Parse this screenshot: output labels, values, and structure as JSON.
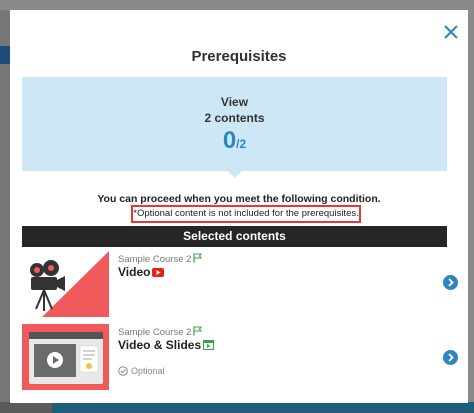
{
  "modal": {
    "title": "Prerequisites",
    "close_icon": "close-icon",
    "status": {
      "line1": "View",
      "line2": "2 contents",
      "completed": "0",
      "total": "/2"
    },
    "condition_text": "You can proceed when you meet the following condition.",
    "note_text": "*Optional content is not included for the prerequisites.",
    "section_title": "Selected contents",
    "items": [
      {
        "course": "Sample Course 2",
        "title": "Video",
        "type_icon": "youtube-icon",
        "optional": ""
      },
      {
        "course": "Sample Course 2",
        "title": "Video & Slides",
        "type_icon": "slides-icon",
        "optional": "Optional"
      }
    ]
  },
  "colors": {
    "accent_blue": "#2e86c1",
    "status_bg": "#cde7f7",
    "note_border": "#e03a3a",
    "section_bar": "#262626",
    "thumb_red": "#f05a5a"
  }
}
